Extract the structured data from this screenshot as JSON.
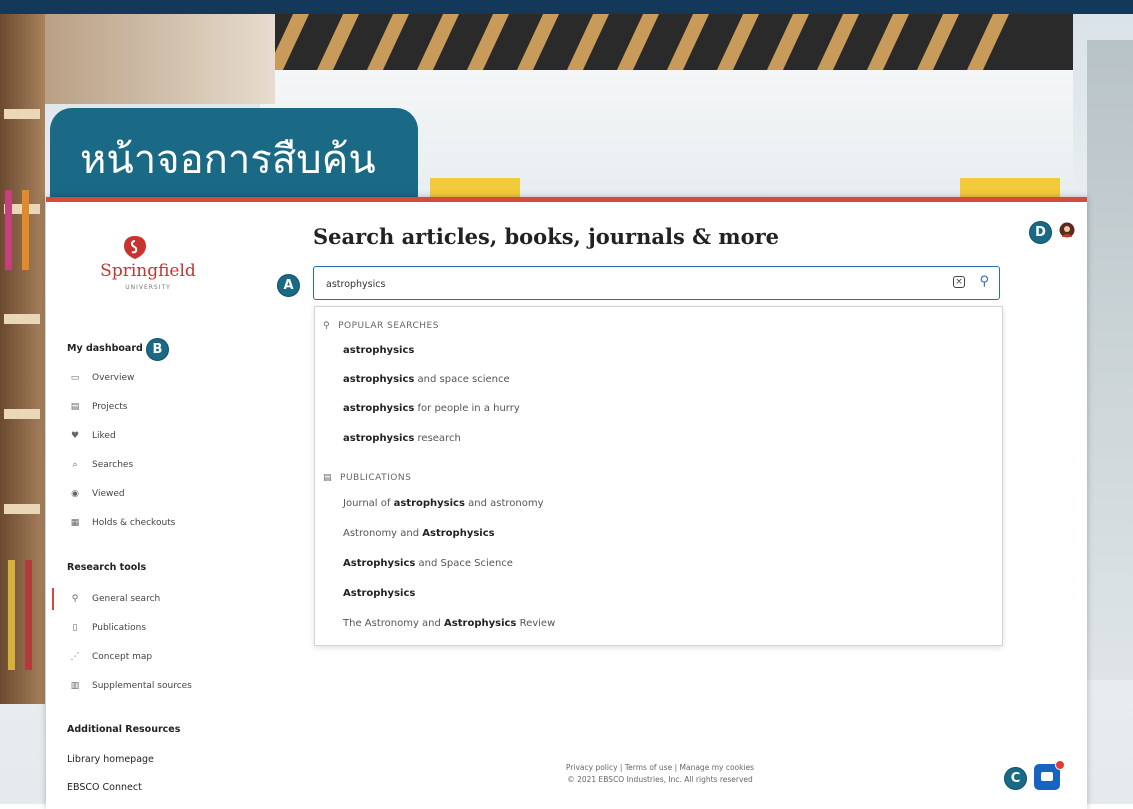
{
  "heading": {
    "title": "หน้าจอการสืบค้น"
  },
  "badges": {
    "a": "A",
    "b": "B",
    "c": "C",
    "d": "D"
  },
  "logo": {
    "name": "Springfield",
    "subtitle": "UNIVERSITY"
  },
  "sidebar": {
    "dashboard_heading": "My dashboard",
    "dashboard_items": [
      {
        "label": "Overview",
        "icon": "overview-icon"
      },
      {
        "label": "Projects",
        "icon": "projects-icon"
      },
      {
        "label": "Liked",
        "icon": "heart-icon"
      },
      {
        "label": "Searches",
        "icon": "searches-icon"
      },
      {
        "label": "Viewed",
        "icon": "eye-icon"
      },
      {
        "label": "Holds & checkouts",
        "icon": "holds-icon"
      }
    ],
    "tools_heading": "Research tools",
    "tools_items": [
      {
        "label": "General search",
        "icon": "search-icon",
        "active": true
      },
      {
        "label": "Publications",
        "icon": "publications-icon"
      },
      {
        "label": "Concept map",
        "icon": "concept-map-icon"
      },
      {
        "label": "Supplemental sources",
        "icon": "supplemental-icon"
      }
    ],
    "additional_heading": "Additional Resources",
    "additional_links": [
      "Library homepage",
      "EBSCO Connect"
    ]
  },
  "main": {
    "title": "Search articles, books, journals & more",
    "search": {
      "value": "astrophysics",
      "placeholder": ""
    }
  },
  "dropdown": {
    "popular_heading": "POPULAR SEARCHES",
    "popular": [
      {
        "bold": "astrophysics",
        "rest": ""
      },
      {
        "bold": "astrophysics",
        "rest": " and space science"
      },
      {
        "bold": "astrophysics",
        "rest": " for people in a hurry"
      },
      {
        "bold": "astrophysics",
        "rest": " research"
      }
    ],
    "publications_heading": "PUBLICATIONS",
    "publications": [
      {
        "pre": "Journal of ",
        "bold": "astrophysics",
        "rest": " and astronomy"
      },
      {
        "pre": "Astronomy and ",
        "bold": "Astrophysics",
        "rest": ""
      },
      {
        "pre": "",
        "bold": "Astrophysics",
        "rest": " and Space Science"
      },
      {
        "pre": "",
        "bold": "Astrophysics",
        "rest": ""
      },
      {
        "pre": "The Astronomy and ",
        "bold": "Astrophysics",
        "rest": " Review"
      }
    ]
  },
  "footer": {
    "privacy": "Privacy policy",
    "terms": "Terms of use",
    "cookies": "Manage my cookies",
    "separator": "|",
    "copyright": "© 2021 EBSCO Industries, Inc. All rights reserved"
  },
  "colors": {
    "accent": "#d44b3c",
    "brand": "#1a6a86",
    "link": "#2b6cb0"
  }
}
